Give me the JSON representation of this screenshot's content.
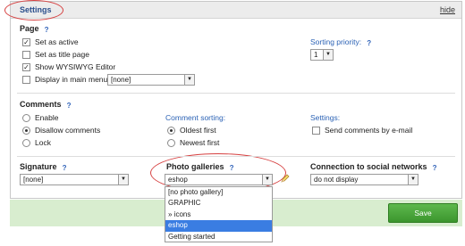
{
  "header": {
    "title": "Settings",
    "hide_label": "hide"
  },
  "page": {
    "title": "Page",
    "options": [
      {
        "label": "Set as active",
        "checked": true
      },
      {
        "label": "Set as title page",
        "checked": false
      },
      {
        "label": "Show WYSIWYG Editor",
        "checked": true
      },
      {
        "label": "Display in main menu",
        "checked": false
      }
    ],
    "main_menu_value": "[none]",
    "sorting_priority_label": "Sorting priority:",
    "sorting_priority_value": "1"
  },
  "comments": {
    "title": "Comments",
    "modes": [
      {
        "label": "Enable",
        "selected": false
      },
      {
        "label": "Disallow comments",
        "selected": true
      },
      {
        "label": "Lock",
        "selected": false
      }
    ],
    "sorting_label": "Comment sorting:",
    "sorting": [
      {
        "label": "Oldest first",
        "selected": true
      },
      {
        "label": "Newest first",
        "selected": false
      }
    ],
    "settings_label": "Settings:",
    "email_label": "Send comments by e-mail",
    "email_checked": false
  },
  "signature": {
    "title": "Signature",
    "value": "[none]"
  },
  "photo_galleries": {
    "title": "Photo galleries",
    "value": "eshop",
    "options": [
      {
        "label": "[no photo gallery]",
        "selected": false
      },
      {
        "label": "GRAPHIC",
        "selected": false
      },
      {
        "label": "» icons",
        "selected": false
      },
      {
        "label": "eshop",
        "selected": true
      },
      {
        "label": "Getting started",
        "selected": false
      }
    ]
  },
  "social": {
    "title": "Connection to social networks",
    "value": "do not display"
  },
  "footer": {
    "save_label": "Save"
  },
  "help_glyph": "?",
  "icons": {
    "help": "help-icon",
    "dropdown_arrow": "triangle-down-icon",
    "edit": "pencil-icon"
  },
  "colors": {
    "accent_blue": "#2b62b5",
    "save_green": "#3c962e",
    "footer_bg": "#d8edcf",
    "highlight_red": "#d64040",
    "selected_option": "#3a7de2"
  }
}
